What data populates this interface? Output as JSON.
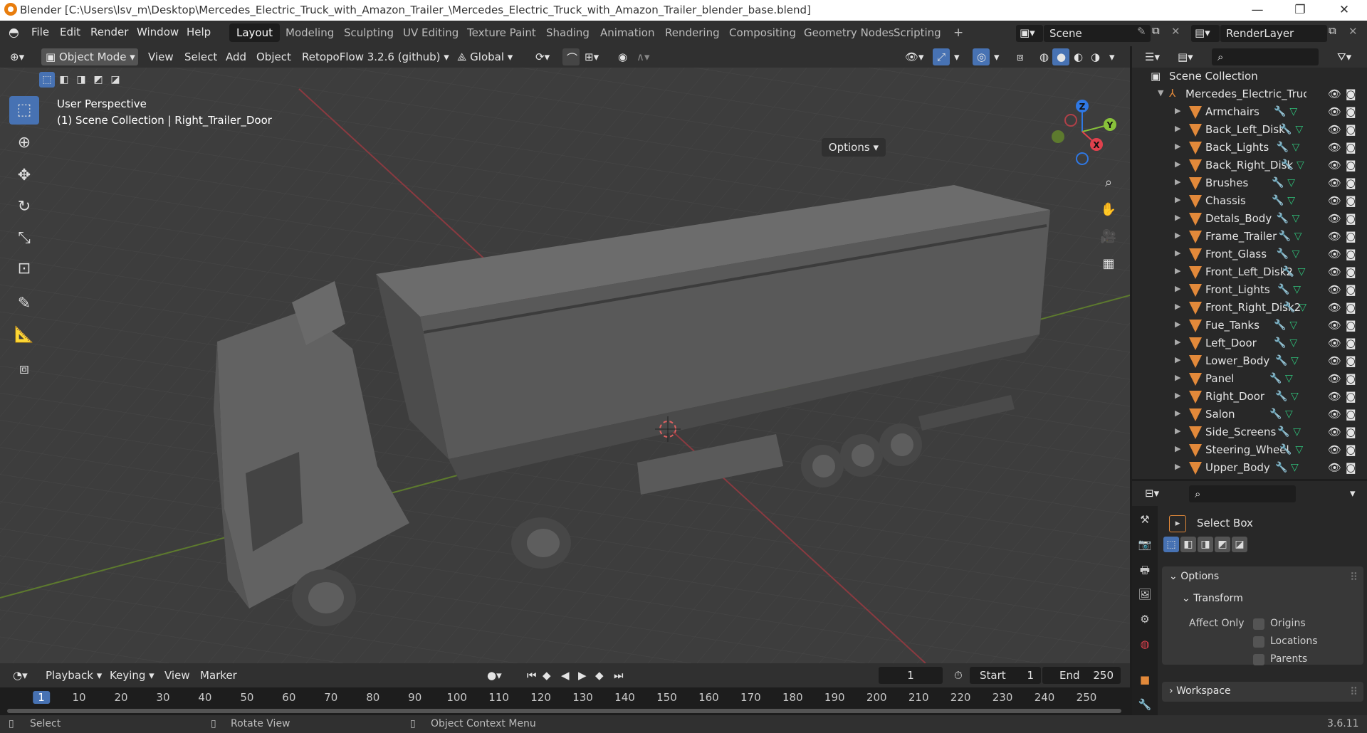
{
  "title_bar": {
    "text": "Blender [C:\\Users\\lsv_m\\Desktop\\Mercedes_Electric_Truck_with_Amazon_Trailer_\\Mercedes_Electric_Truck_with_Amazon_Trailer_blender_base.blend]",
    "minimize": "—",
    "maximize": "❐",
    "close": "✕"
  },
  "menu": {
    "file": "File",
    "edit": "Edit",
    "render": "Render",
    "window": "Window",
    "help": "Help"
  },
  "workspaces": [
    "Layout",
    "Modeling",
    "Sculpting",
    "UV Editing",
    "Texture Paint",
    "Shading",
    "Animation",
    "Rendering",
    "Compositing",
    "Geometry Nodes",
    "Scripting",
    "+"
  ],
  "scene": {
    "name": "Scene",
    "render_layer": "RenderLayer"
  },
  "viewport_header": {
    "mode": "Object Mode",
    "view": "View",
    "select": "Select",
    "add": "Add",
    "object": "Object",
    "addon": "RetopoFlow 3.2.6 (github)",
    "orientation": "Global",
    "options": "Options"
  },
  "viewport": {
    "perspective": "User Perspective",
    "context": "(1) Scene Collection | Right_Trailer_Door",
    "gizmo": {
      "x": "X",
      "y": "Y",
      "z": "Z"
    }
  },
  "outliner": {
    "root": "Scene Collection",
    "collection": "Mercedes_Electric_Truck_v",
    "objects": [
      "Armchairs",
      "Back_Left_Disk",
      "Back_Lights",
      "Back_Right_Disk",
      "Brushes",
      "Chassis",
      "Detals_Body",
      "Frame_Trailer",
      "Front_Glass",
      "Front_Left_Disk2",
      "Front_Lights",
      "Front_Right_Disk2",
      "Fue_Tanks",
      "Left_Door",
      "Lower_Body",
      "Panel",
      "Right_Door",
      "Salon",
      "Side_Screens",
      "Steering_Wheel",
      "Upper_Body"
    ]
  },
  "properties": {
    "tool": "Select Box",
    "options": "Options",
    "transform": "Transform",
    "affect_only": "Affect Only",
    "origins": "Origins",
    "locations": "Locations",
    "parents": "Parents",
    "workspace": "Workspace"
  },
  "timeline": {
    "playback": "Playback",
    "keying": "Keying",
    "view": "View",
    "marker": "Marker",
    "current_frame": "1",
    "start_label": "Start",
    "start": "1",
    "end_label": "End",
    "end": "250",
    "ticks": [
      "1",
      "10",
      "20",
      "30",
      "40",
      "50",
      "60",
      "70",
      "80",
      "90",
      "100",
      "110",
      "120",
      "130",
      "140",
      "150",
      "160",
      "170",
      "180",
      "190",
      "200",
      "210",
      "220",
      "230",
      "240",
      "250"
    ]
  },
  "status": {
    "select": "Select",
    "rotate": "Rotate View",
    "context": "Object Context Menu",
    "version": "3.6.11"
  },
  "colors": {
    "accent": "#4772b3",
    "mesh": "#e2893a",
    "x_axis": "#e0414d",
    "y_axis": "#88c23a",
    "z_axis": "#2f78e4"
  }
}
